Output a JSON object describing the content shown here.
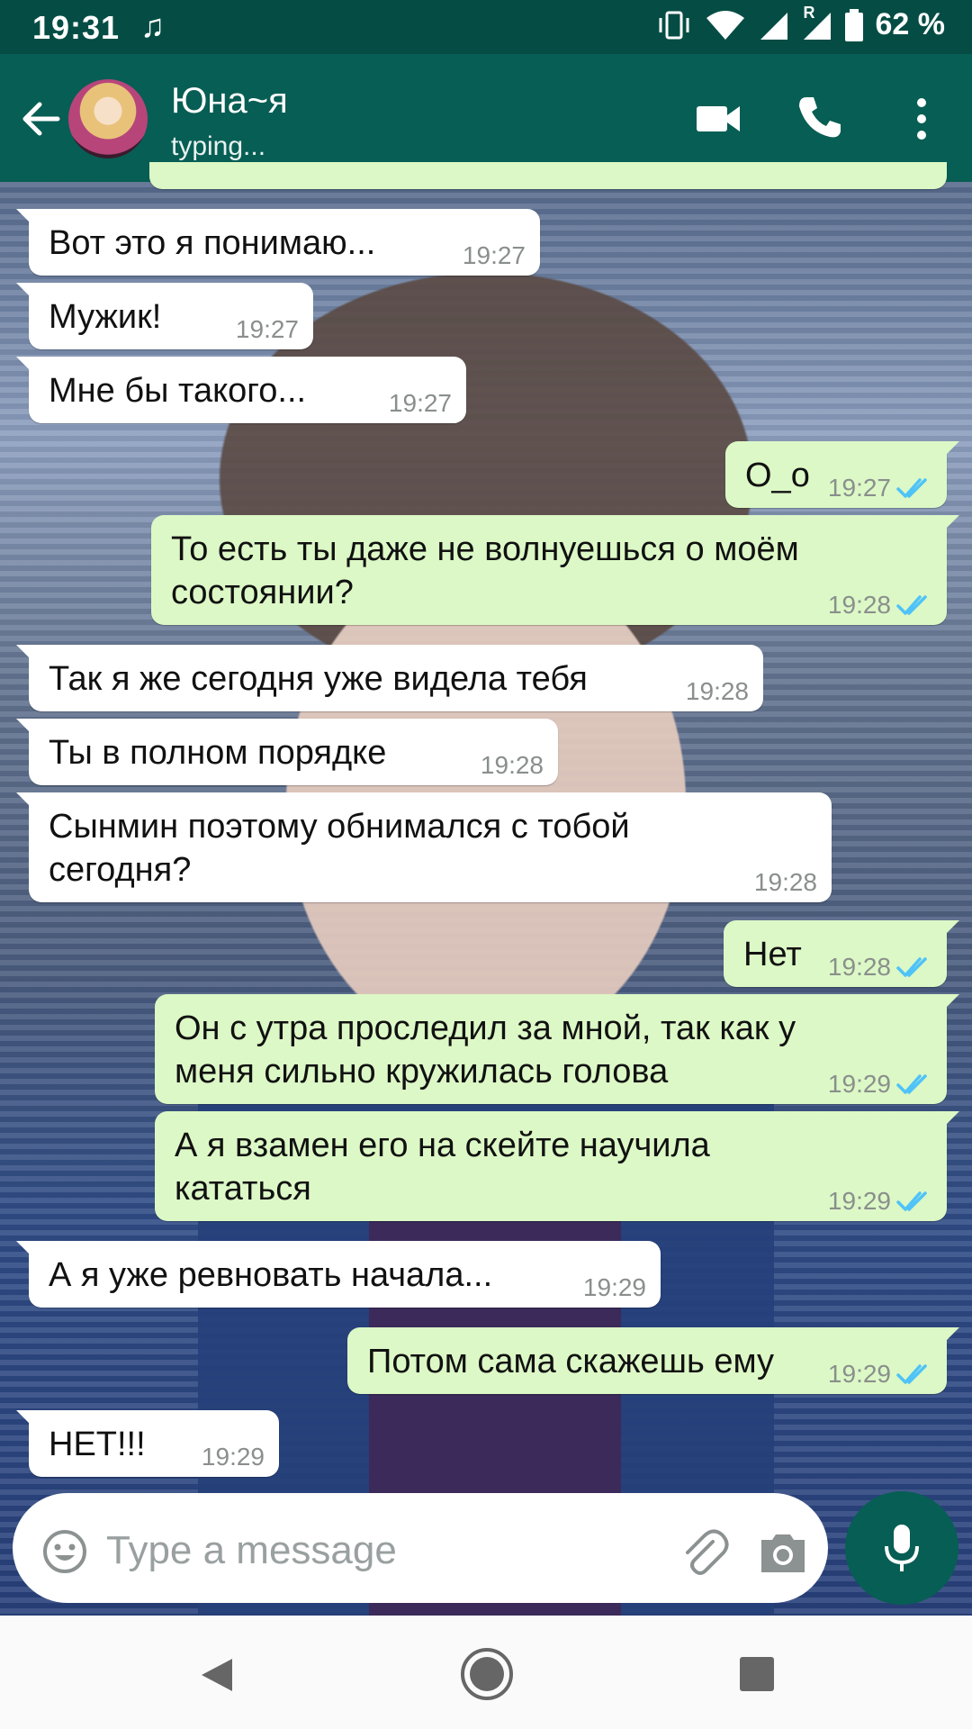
{
  "status_bar": {
    "time": "19:31",
    "battery": "62 %",
    "roaming": "R"
  },
  "header": {
    "contact_name": "Юна~я",
    "status": "typing..."
  },
  "messages": [
    {
      "dir": "in",
      "text": [
        "Вот это я понимаю..."
      ],
      "time": "19:27"
    },
    {
      "dir": "in",
      "text": [
        "Мужик!"
      ],
      "time": "19:27"
    },
    {
      "dir": "in",
      "text": [
        "Мне бы такого..."
      ],
      "time": "19:27"
    },
    {
      "dir": "out",
      "text": [
        "О_о"
      ],
      "time": "19:27",
      "read": true
    },
    {
      "dir": "out",
      "text": [
        "То есть ты даже не волнуешься о моём",
        "состоянии?"
      ],
      "time": "19:28",
      "read": true
    },
    {
      "dir": "in",
      "text": [
        "Так я же сегодня уже видела тебя"
      ],
      "time": "19:28"
    },
    {
      "dir": "in",
      "text": [
        "Ты в полном порядке"
      ],
      "time": "19:28"
    },
    {
      "dir": "in",
      "text": [
        "Сынмин поэтому обнимался с тобой",
        "сегодня?"
      ],
      "time": "19:28"
    },
    {
      "dir": "out",
      "text": [
        "Нет"
      ],
      "time": "19:28",
      "read": true
    },
    {
      "dir": "out",
      "text": [
        "Он с утра проследил за мной, так как у",
        "меня сильно кружилась голова"
      ],
      "time": "19:29",
      "read": true
    },
    {
      "dir": "out",
      "text": [
        "А я взамен его на скейте научила",
        "кататься"
      ],
      "time": "19:29",
      "read": true
    },
    {
      "dir": "in",
      "text": [
        "А я уже ревновать начала..."
      ],
      "time": "19:29"
    },
    {
      "dir": "out",
      "text": [
        "Потом сама скажешь ему"
      ],
      "time": "19:29",
      "read": true
    },
    {
      "dir": "in",
      "text": [
        "НЕТ!!!"
      ],
      "time": "19:29"
    }
  ],
  "composer": {
    "placeholder": "Type a message"
  },
  "colors": {
    "header": "#075e54",
    "status_bar": "#054d44",
    "outgoing": "#dcf8c6",
    "incoming": "#ffffff",
    "read_ticks": "#4fc3f7"
  },
  "icons": {
    "back": "arrow-left-icon",
    "video": "video-camera-icon",
    "call": "phone-icon",
    "more": "more-vertical-icon",
    "emoji": "smiley-icon",
    "attach": "paperclip-icon",
    "camera": "camera-icon",
    "mic": "microphone-icon"
  }
}
